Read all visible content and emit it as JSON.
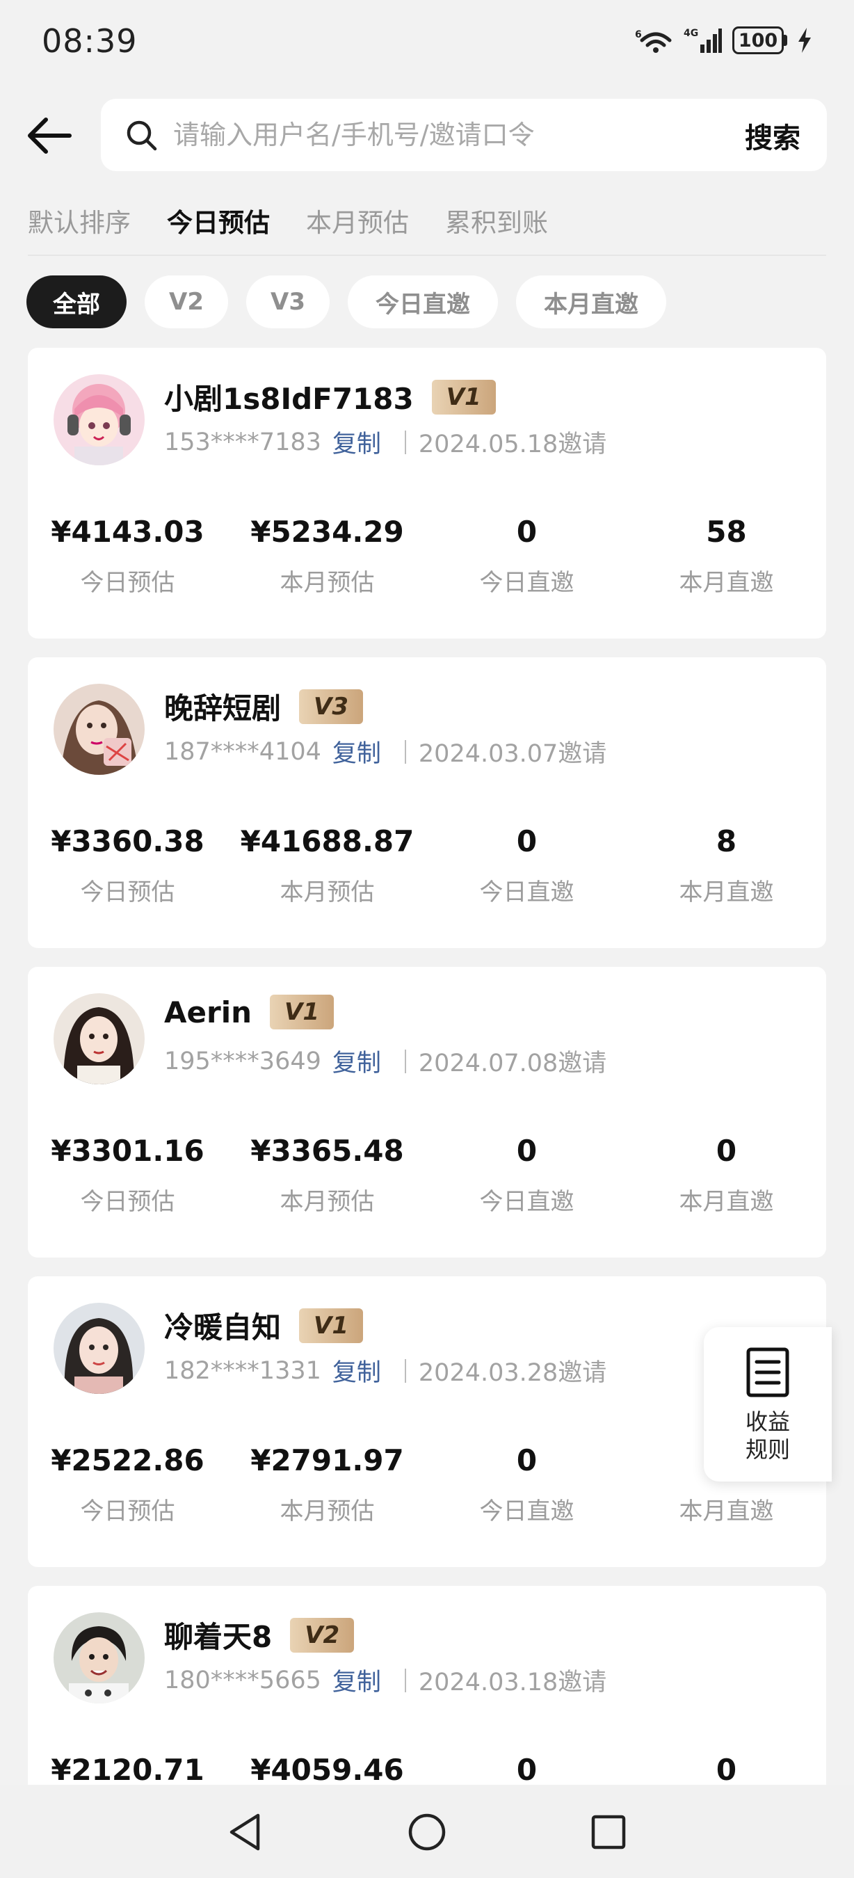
{
  "status": {
    "time": "08:39",
    "battery": "100",
    "network": "4G",
    "wifi_label": "6"
  },
  "search": {
    "placeholder": "请输入用户名/手机号/邀请口令",
    "button": "搜索"
  },
  "sort_tabs": [
    {
      "label": "默认排序",
      "active": false
    },
    {
      "label": "今日预估",
      "active": true
    },
    {
      "label": "本月预估",
      "active": false
    },
    {
      "label": "累积到账",
      "active": false
    }
  ],
  "filters": [
    {
      "label": "全部",
      "active": true
    },
    {
      "label": "V2",
      "active": false
    },
    {
      "label": "V3",
      "active": false
    },
    {
      "label": "今日直邀",
      "active": false
    },
    {
      "label": "本月直邀",
      "active": false
    }
  ],
  "copy_label": "复制",
  "stat_labels": [
    "今日预估",
    "本月预估",
    "今日直邀",
    "本月直邀"
  ],
  "users": [
    {
      "name": "小剧1s8IdF7183",
      "level": "V1",
      "phone": "153****7183",
      "invite_date": "2024.05.18邀请",
      "stats": [
        "¥4143.03",
        "¥5234.29",
        "0",
        "58"
      ]
    },
    {
      "name": "晚辞短剧",
      "level": "V3",
      "phone": "187****4104",
      "invite_date": "2024.03.07邀请",
      "stats": [
        "¥3360.38",
        "¥41688.87",
        "0",
        "8"
      ]
    },
    {
      "name": "Aerin",
      "level": "V1",
      "phone": "195****3649",
      "invite_date": "2024.07.08邀请",
      "stats": [
        "¥3301.16",
        "¥3365.48",
        "0",
        "0"
      ]
    },
    {
      "name": "冷暖自知",
      "level": "V1",
      "phone": "182****1331",
      "invite_date": "2024.03.28邀请",
      "stats": [
        "¥2522.86",
        "¥2791.97",
        "0",
        ""
      ]
    },
    {
      "name": "聊着天8",
      "level": "V2",
      "phone": "180****5665",
      "invite_date": "2024.03.18邀请",
      "stats": [
        "¥2120.71",
        "¥4059.46",
        "0",
        "0"
      ]
    }
  ],
  "float_button": {
    "line1": "收益",
    "line2": "规则"
  },
  "colors": {
    "accent_link": "#40629b",
    "chip_active": "#1c1c1c",
    "badge_gold": "#cba57b"
  }
}
